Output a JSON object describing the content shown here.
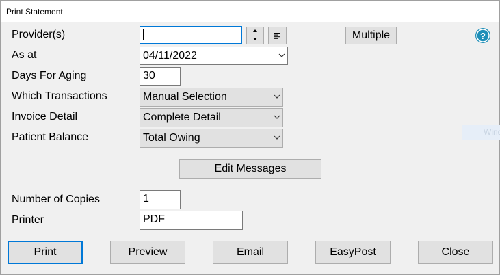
{
  "window": {
    "title": "Print Statement"
  },
  "form": {
    "providers": {
      "label": "Provider(s)",
      "value": ""
    },
    "as_at": {
      "label": "As at",
      "value": "04/11/2022"
    },
    "days_for_aging": {
      "label": "Days For Aging",
      "value": "30"
    },
    "which_transactions": {
      "label": "Which Transactions",
      "value": "Manual Selection"
    },
    "invoice_detail": {
      "label": "Invoice Detail",
      "value": "Complete Detail"
    },
    "patient_balance": {
      "label": "Patient Balance",
      "value": "Total Owing"
    },
    "number_of_copies": {
      "label": "Number of Copies",
      "value": "1"
    },
    "printer": {
      "label": "Printer",
      "value": "PDF"
    }
  },
  "buttons": {
    "multiple": "Multiple",
    "edit_messages": "Edit Messages",
    "print": "Print",
    "preview": "Preview",
    "email": "Email",
    "easypost": "EasyPost",
    "close": "Close"
  },
  "background_fragment": "Wind",
  "icons": {
    "help": "help-icon",
    "spin": "spin-up-down-icon",
    "align": "align-left-icon",
    "dropdown": "chevron-down-icon"
  },
  "colors": {
    "accent": "#0078d7",
    "help": "#1e8fb8"
  }
}
